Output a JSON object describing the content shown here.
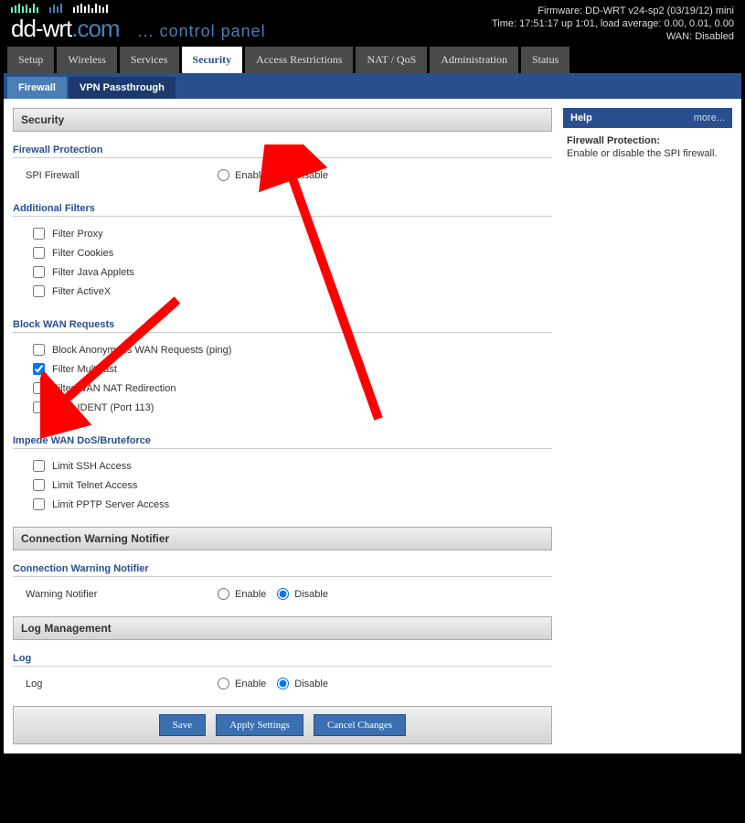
{
  "status": {
    "firmware": "Firmware: DD-WRT v24-sp2 (03/19/12) mini",
    "time": "Time: 17:51:17 up 1:01, load average: 0.00, 0.01, 0.00",
    "wan": "WAN: Disabled"
  },
  "logo": {
    "brand": "dd-wrt",
    "tld": ".com",
    "cp": "... control panel"
  },
  "maintabs": [
    "Setup",
    "Wireless",
    "Services",
    "Security",
    "Access Restrictions",
    "NAT / QoS",
    "Administration",
    "Status"
  ],
  "maintab_active": 3,
  "subtabs": [
    "Firewall",
    "VPN Passthrough"
  ],
  "subtab_active": 0,
  "panels": {
    "security": "Security",
    "cwn": "Connection Warning Notifier",
    "log": "Log Management"
  },
  "sections": {
    "fw_protection": "Firewall Protection",
    "add_filters": "Additional Filters",
    "block_wan": "Block WAN Requests",
    "impede": "Impede WAN DoS/Bruteforce",
    "cwn": "Connection Warning Notifier",
    "log": "Log"
  },
  "labels": {
    "spi": "SPI Firewall",
    "enable": "Enable",
    "disable": "Disable",
    "warning_notifier": "Warning Notifier",
    "log": "Log"
  },
  "filters": {
    "proxy": "Filter Proxy",
    "cookies": "Filter Cookies",
    "java": "Filter Java Applets",
    "activex": "Filter ActiveX"
  },
  "wan": {
    "block_anon": "Block Anonymous WAN Requests (ping)",
    "multicast": "Filter Multicast",
    "nat": "Filter WAN NAT Redirection",
    "ident": "Filter IDENT (Port 113)"
  },
  "impede": {
    "ssh": "Limit SSH Access",
    "telnet": "Limit Telnet Access",
    "pptp": "Limit PPTP Server Access"
  },
  "buttons": {
    "save": "Save",
    "apply": "Apply Settings",
    "cancel": "Cancel Changes"
  },
  "help": {
    "title": "Help",
    "more": "more...",
    "h1": "Firewall Protection:",
    "t1": "Enable or disable the SPI firewall."
  },
  "radio_state": {
    "spi": "disable",
    "warning": "disable",
    "log": "disable"
  },
  "check_state": {
    "multicast": true
  }
}
